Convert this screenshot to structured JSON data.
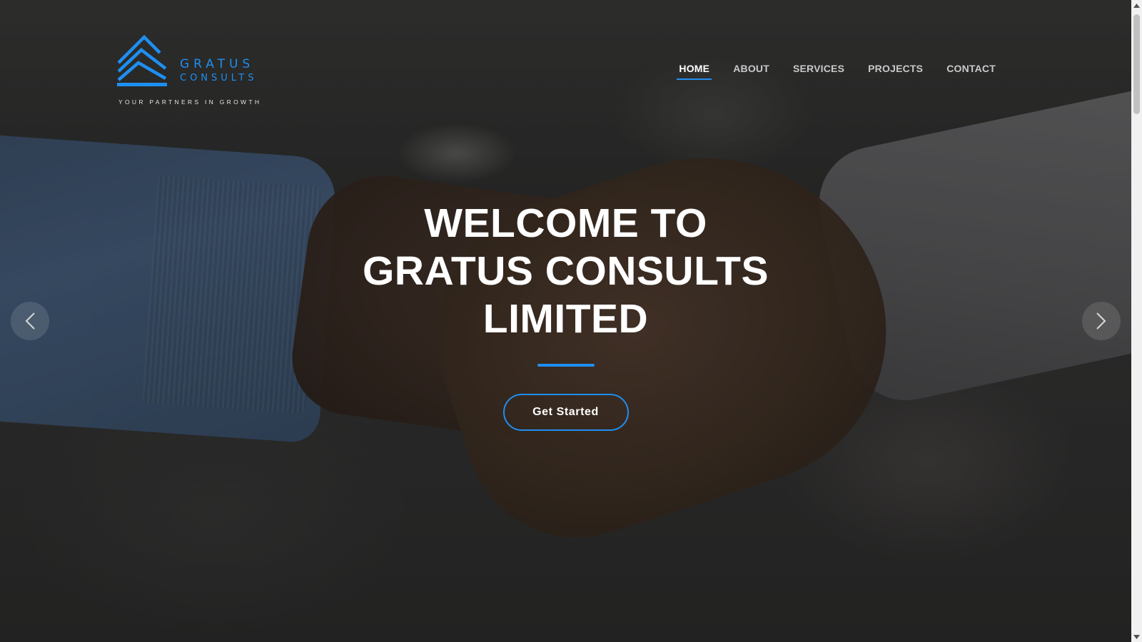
{
  "brand": {
    "name": "GRATUS",
    "sub": "CONSULTS",
    "tagline": "YOUR PARTNERS IN GROWTH",
    "accent_color": "#1e8ff0"
  },
  "nav": {
    "items": [
      {
        "label": "HOME",
        "active": true
      },
      {
        "label": "ABOUT",
        "active": false
      },
      {
        "label": "SERVICES",
        "active": false
      },
      {
        "label": "PROJECTS",
        "active": false
      },
      {
        "label": "CONTACT",
        "active": false
      }
    ]
  },
  "hero": {
    "title_line1": "WELCOME TO",
    "title_line2": "GRATUS CONSULTS",
    "title_line3": "LIMITED",
    "cta_label": "Get Started",
    "background_image": "handshake-photo"
  },
  "carousel": {
    "prev_icon": "chevron-left-icon",
    "next_icon": "chevron-right-icon"
  }
}
